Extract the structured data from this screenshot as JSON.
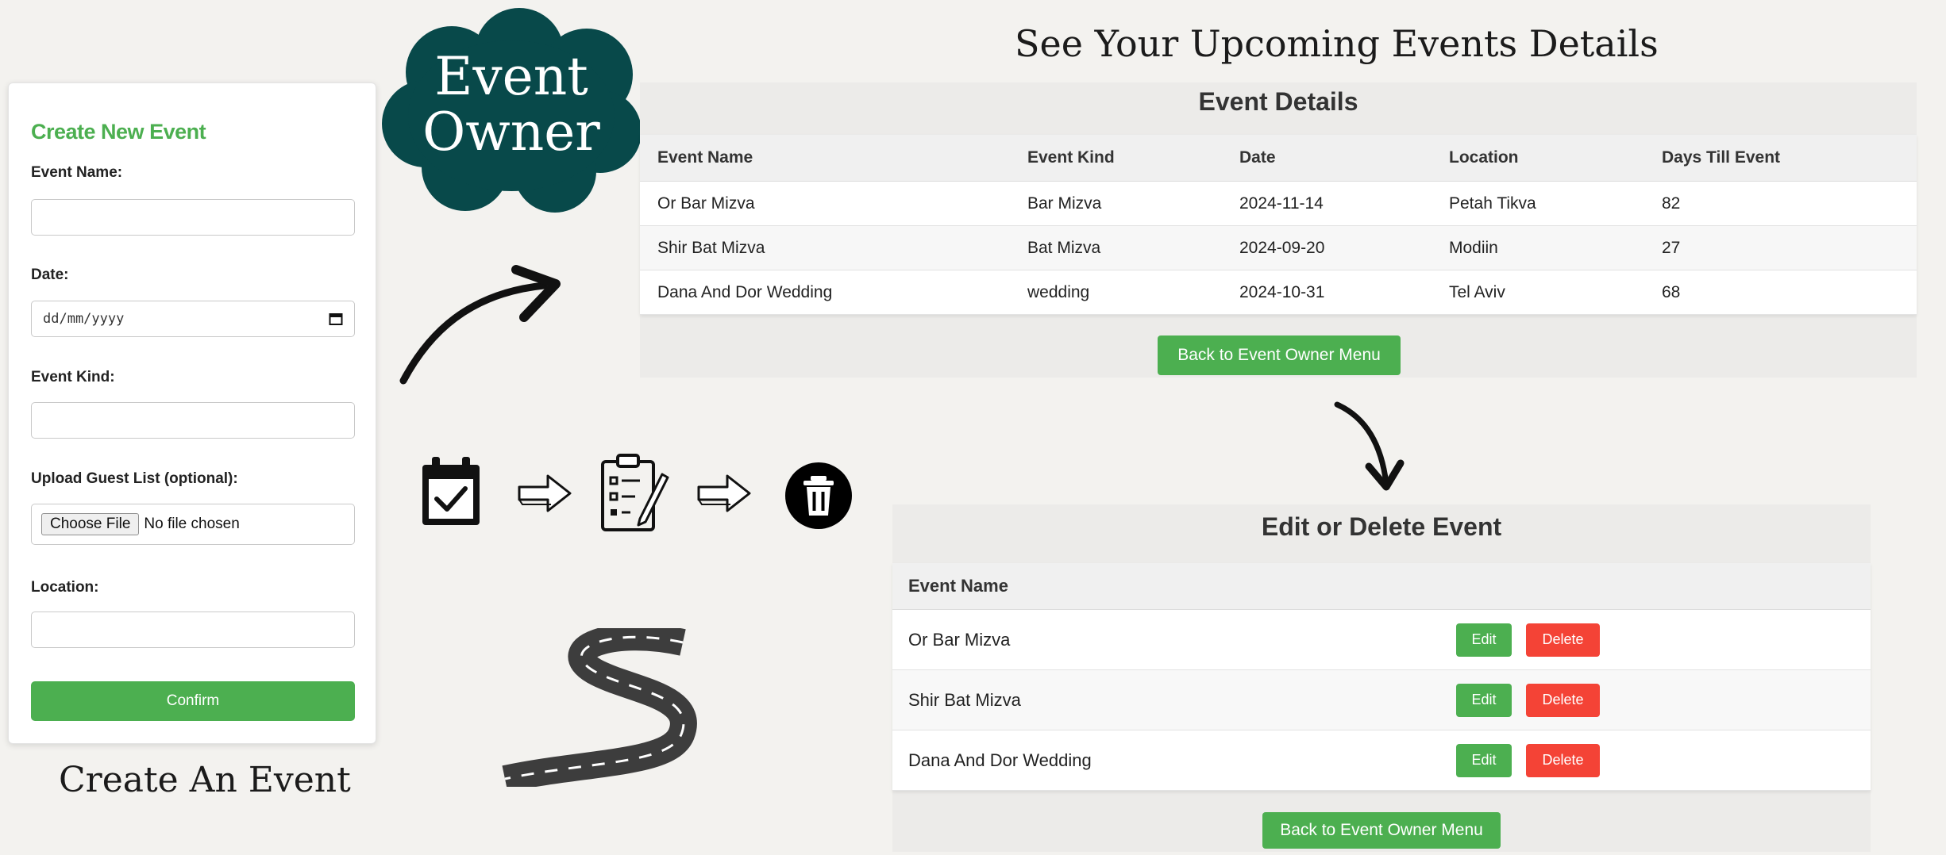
{
  "form": {
    "title": "Create New Event",
    "event_name_label": "Event Name:",
    "date_label": "Date:",
    "date_placeholder": "dd/mm/yyyy",
    "event_kind_label": "Event Kind:",
    "guest_list_label": "Upload Guest List (optional):",
    "choose_file_label": "Choose File",
    "no_file_text": "No file chosen",
    "location_label": "Location:",
    "confirm_label": "Confirm"
  },
  "captions": {
    "create": "Create An Event",
    "upcoming": "See Your Upcoming Events Details",
    "cloud_line1": "Event",
    "cloud_line2": "Owner"
  },
  "details": {
    "title": "Event Details",
    "columns": [
      "Event Name",
      "Event Kind",
      "Date",
      "Location",
      "Days Till Event"
    ],
    "rows": [
      [
        "Or Bar Mizva",
        "Bar Mizva",
        "2024-11-14",
        "Petah Tikva",
        "82"
      ],
      [
        "Shir Bat Mizva",
        "Bat Mizva",
        "2024-09-20",
        "Modiin",
        "27"
      ],
      [
        "Dana And Dor Wedding",
        "wedding",
        "2024-10-31",
        "Tel Aviv",
        "68"
      ]
    ],
    "back_label": "Back to Event Owner Menu"
  },
  "edit": {
    "title": "Edit or Delete Event",
    "column": "Event Name",
    "rows": [
      "Or Bar Mizva",
      "Shir Bat Mizva",
      "Dana And Dor Wedding"
    ],
    "edit_label": "Edit",
    "delete_label": "Delete",
    "back_label": "Back to Event Owner Menu"
  },
  "colors": {
    "accent_green": "#4caf50",
    "delete_red": "#f44336",
    "cloud_teal": "#08494a",
    "background": "#f3f2ef"
  },
  "icons": [
    "curved-arrow-icon",
    "calendar-check-icon",
    "right-arrow-icon",
    "clipboard-checklist-icon",
    "trash-icon",
    "road-icon",
    "down-arrow-icon"
  ]
}
